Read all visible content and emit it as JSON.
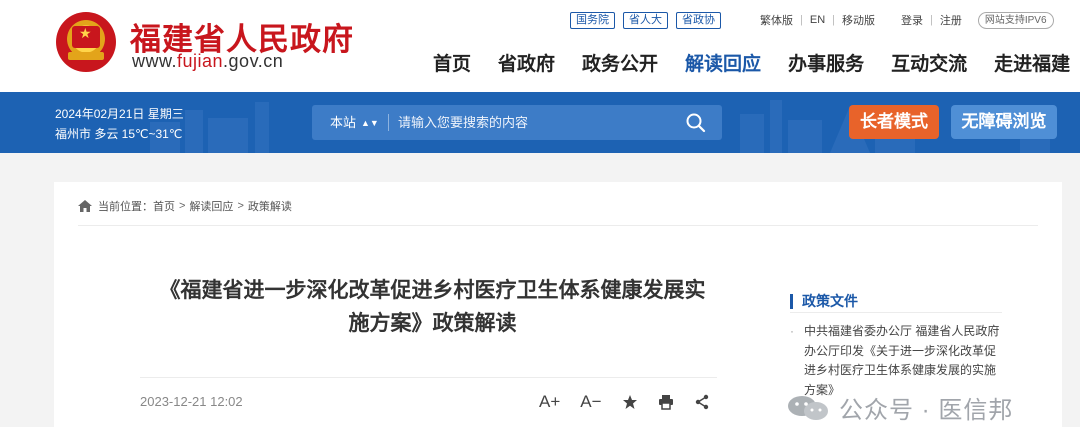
{
  "header": {
    "site_name": "福建省人民政府",
    "url_prefix": "www.",
    "url_highlight": "fujian",
    "url_suffix": ".gov.cn",
    "badges": [
      "国务院",
      "省人大",
      "省政协"
    ],
    "util_links": {
      "traditional": "繁体版",
      "english": "EN",
      "mobile": "移动版",
      "login": "登录",
      "register": "注册",
      "ipv6": "网站支持IPV6"
    },
    "nav": [
      {
        "label": "首页",
        "active": false
      },
      {
        "label": "省政府",
        "active": false
      },
      {
        "label": "政务公开",
        "active": false
      },
      {
        "label": "解读回应",
        "active": true
      },
      {
        "label": "办事服务",
        "active": false
      },
      {
        "label": "互动交流",
        "active": false
      },
      {
        "label": "走进福建",
        "active": false
      }
    ]
  },
  "banner": {
    "date": "2024年02月21日 星期三",
    "weather": "福州市 多云 15℃~31℃",
    "search_scope": "本站",
    "search_placeholder": "请输入您要搜索的内容",
    "elder_mode": "长者模式",
    "accessible_browse": "无障碍浏览"
  },
  "breadcrumb": {
    "prefix": "当前位置：",
    "items": [
      "首页",
      "解读回应",
      "政策解读"
    ],
    "separator": ">"
  },
  "article": {
    "title_line1": "《福建省进一步深化改革促进乡村医疗卫生体系健康发展实",
    "title_line2": "施方案》政策解读",
    "date": "2023-12-21 12:02",
    "font_increase": "A+",
    "font_decrease": "A−"
  },
  "sidebar": {
    "title": "政策文件",
    "bullet": "·",
    "item": "中共福建省委办公厅 福建省人民政府办公厅印发《关于进一步深化改革促进乡村医疗卫生体系健康发展的实施方案》"
  },
  "watermark": {
    "text": "公众号 · 医信邦"
  },
  "colors": {
    "brand_red": "#c8161d",
    "brand_blue": "#1b58a8",
    "banner_blue": "#1d62b3",
    "elder_orange": "#e8632a",
    "access_blue": "#4f8fd6"
  },
  "icons": {
    "emblem": "national-emblem-icon",
    "search": "search-icon",
    "home": "home-icon",
    "favorite": "star-icon",
    "print": "printer-icon",
    "share": "share-icon",
    "watermark": "wechat-icon"
  }
}
